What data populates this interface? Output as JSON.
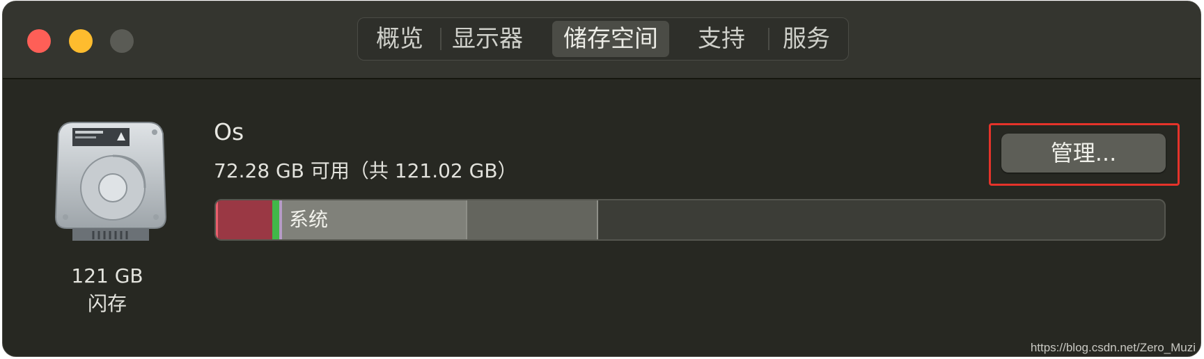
{
  "window": {
    "tabs": [
      {
        "label": "概览",
        "selected": false
      },
      {
        "label": "显示器",
        "selected": false
      },
      {
        "label": "储存空间",
        "selected": true
      },
      {
        "label": "支持",
        "selected": false
      },
      {
        "label": "服务",
        "selected": false
      }
    ]
  },
  "disk": {
    "size": "121 GB",
    "type": "闪存"
  },
  "volume": {
    "name": "Os",
    "info": "72.28 GB 可用（共 121.02 GB）",
    "manage_button": "管理...",
    "bar_segments": [
      {
        "name": "apps",
        "color": "#9a3844"
      },
      {
        "name": "green",
        "color": "#41b849"
      },
      {
        "name": "purple",
        "color": "#b69cc7"
      },
      {
        "name": "system",
        "label": "系统",
        "color": "#80817a"
      },
      {
        "name": "other",
        "color": "#64655e"
      }
    ]
  },
  "colors": {
    "highlight_box": "#e5332a",
    "close": "#fe5f57",
    "minimize": "#febc2e",
    "zoom": "#5a5b55"
  },
  "watermark": "https://blog.csdn.net/Zero_Muzi"
}
